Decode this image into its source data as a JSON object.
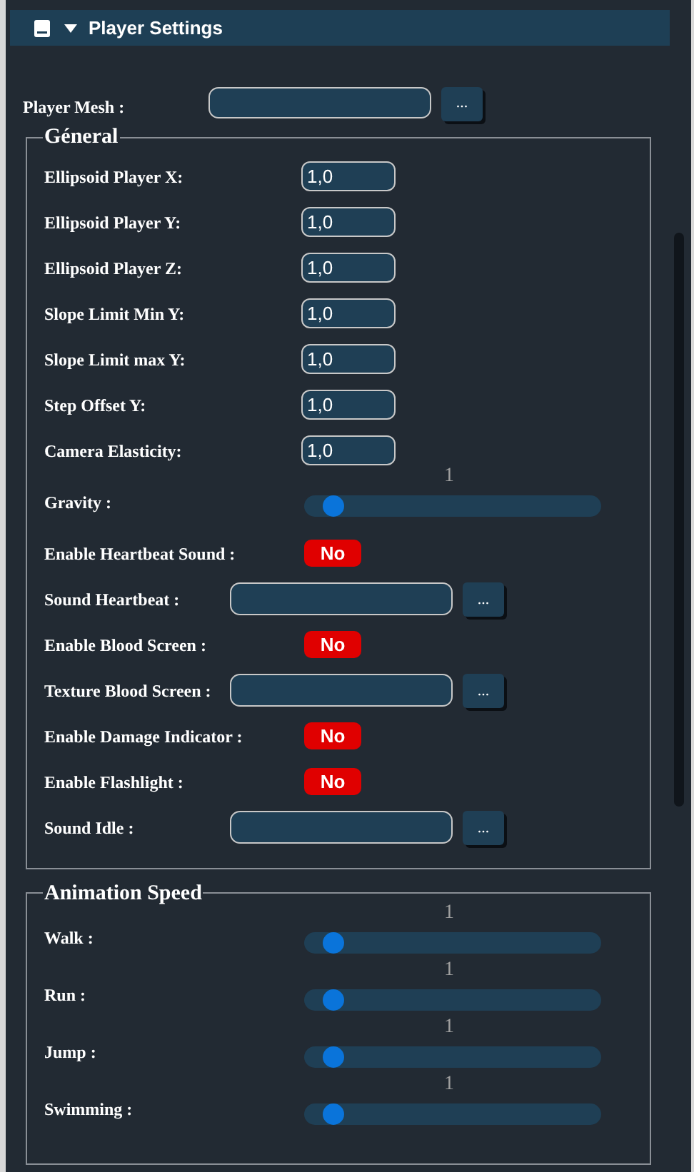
{
  "header": {
    "title": "Player Settings",
    "expanded": true
  },
  "player_mesh": {
    "label": "Player Mesh :",
    "browse": "..."
  },
  "sections": [
    {
      "title": "Géneral",
      "items": [
        {
          "kind": "number",
          "label": "Ellipsoid Player X:",
          "value": "1,0"
        },
        {
          "kind": "number",
          "label": "Ellipsoid Player Y:",
          "value": "1,0"
        },
        {
          "kind": "number",
          "label": "Ellipsoid Player Z:",
          "value": "1,0"
        },
        {
          "kind": "number",
          "label": "Slope Limit Min Y:",
          "value": "1,0"
        },
        {
          "kind": "number",
          "label": "Slope Limit max Y:",
          "value": "1,0"
        },
        {
          "kind": "number",
          "label": "Step Offset Y:",
          "value": "1,0"
        },
        {
          "kind": "number",
          "label": "Camera Elasticity:",
          "value": "1,0"
        },
        {
          "kind": "slider",
          "label": "Gravity :",
          "reading": "1",
          "level": 0.05
        },
        {
          "kind": "toggle",
          "label": "Enable Heartbeat Sound :",
          "on": false,
          "text": "No"
        },
        {
          "kind": "file",
          "label": "Sound Heartbeat :",
          "browse": "..."
        },
        {
          "kind": "toggle",
          "label": "Enable Blood Screen :",
          "on": false,
          "text": "No"
        },
        {
          "kind": "file",
          "label": "Texture Blood Screen :",
          "browse": "..."
        },
        {
          "kind": "toggle",
          "label": "Enable Damage Indicator :",
          "on": false,
          "text": "No"
        },
        {
          "kind": "toggle",
          "label": "Enable Flashlight :",
          "on": false,
          "text": "No"
        },
        {
          "kind": "file",
          "label": "Sound Idle :",
          "browse": "..."
        }
      ]
    },
    {
      "title": "Animation Speed",
      "items": [
        {
          "kind": "slider",
          "label": "Walk :",
          "reading": "1",
          "level": 0.05
        },
        {
          "kind": "slider",
          "label": "Run :",
          "reading": "1",
          "level": 0.05
        },
        {
          "kind": "slider",
          "label": "Jump :",
          "reading": "1",
          "level": 0.05
        },
        {
          "kind": "slider",
          "label": "Swimming :",
          "reading": "1",
          "level": 0.05
        }
      ]
    }
  ]
}
